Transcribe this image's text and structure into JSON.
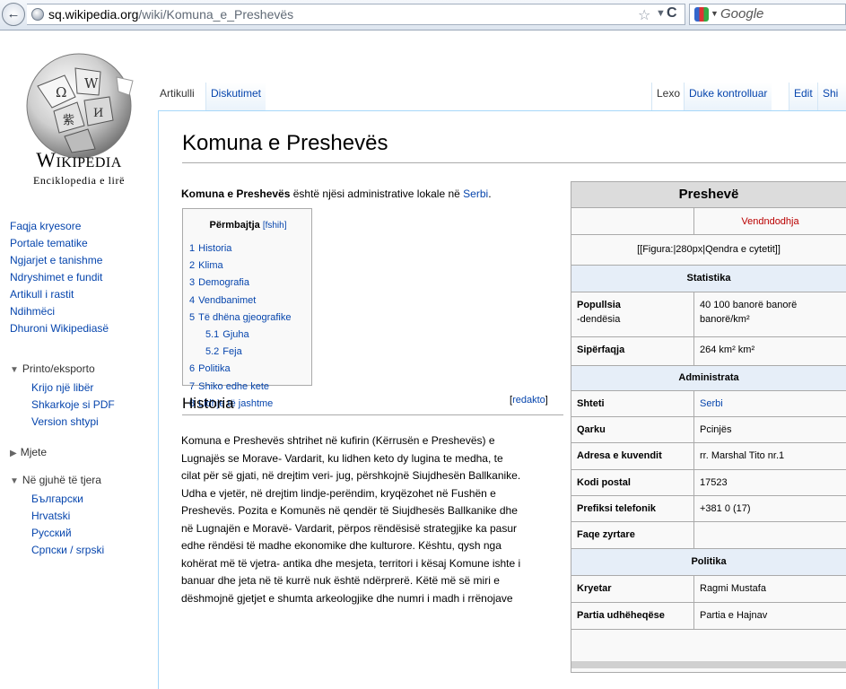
{
  "browser": {
    "url_host": "sq.wikipedia.org",
    "url_path": "/wiki/Komuna_e_Preshevës",
    "search_placeholder": "Google",
    "icons": [
      "back-arrow-icon",
      "site-identity-icon",
      "bookmark-star-icon",
      "dropdown-arrow-icon",
      "reload-icon",
      "search-engine-icon"
    ]
  },
  "logo": {
    "wordmark": "Wikipedia",
    "tagline": "Enciklopedia e lirë"
  },
  "nav": {
    "main": [
      "Faqja kryesore",
      "Portale tematike",
      "Ngjarjet e tanishme",
      "Ndryshimet e fundit",
      "Artikull i rastit",
      "Ndihmëci",
      "Dhuroni Wikipediasë"
    ],
    "print_heading": "Printo/eksporto",
    "print_items": [
      "Krijo një libër",
      "Shkarkoje si PDF",
      "Version shtypi"
    ],
    "tools_heading": "Mjete",
    "languages_heading": "Në gjuhë të tjera",
    "languages": [
      "Български",
      "Hrvatski",
      "Русский",
      "Српски / srpski"
    ]
  },
  "tabs": {
    "article": "Artikulli",
    "discussion": "Diskutimet",
    "read": "Lexo",
    "history": "Duke kontrolluar",
    "edit": "Edit",
    "more": "Shi"
  },
  "article": {
    "title": "Komuna e Preshevës",
    "lead_bold": "Komuna e Preshevës",
    "lead_text": " është njësi administrative lokale në ",
    "lead_link": "Serbi",
    "lead_end": "."
  },
  "toc": {
    "title": "Përmbajtja",
    "toggle_open": "[",
    "toggle": "fshih",
    "toggle_close": "]",
    "items": [
      {
        "num": "1",
        "label": "Historia",
        "sub": false
      },
      {
        "num": "2",
        "label": "Klima",
        "sub": false
      },
      {
        "num": "3",
        "label": "Demografia",
        "sub": false
      },
      {
        "num": "4",
        "label": "Vendbanimet",
        "sub": false
      },
      {
        "num": "5",
        "label": "Të dhëna gjeografike",
        "sub": false
      },
      {
        "num": "5.1",
        "label": "Gjuha",
        "sub": true
      },
      {
        "num": "5.2",
        "label": "Feja",
        "sub": true
      },
      {
        "num": "6",
        "label": "Politika",
        "sub": false
      },
      {
        "num": "7",
        "label": "Shiko edhe kete",
        "sub": false
      },
      {
        "num": "8",
        "label": "Lidhje të jashtme",
        "sub": false
      }
    ]
  },
  "historia": {
    "heading": "Historia",
    "edit_open": "[",
    "edit": "redakto",
    "edit_close": "]",
    "lines": [
      "Komuna e Preshevës shtrihet në kufirin (Kërrusën e Preshevës) e",
      "Lugnajës se Morave- Vardarit, ku lidhen keto dy lugina te medha, te",
      "cilat për së gjati, në drejtim veri- jug, përshkojnë Siujdhesën Ballkanike.",
      "Udha e vjetër, në drejtim lindje-perëndim, kryqëzohet në Fushën e",
      "Preshevës. Pozita e Komunës në qendër të Siujdhesës Ballkanike dhe",
      "në Lugnajën e Moravë- Vardarit, përpos rëndësisë strategjike ka pasur",
      "edhe rëndësi të madhe ekonomike dhe kulturore. Kështu, qysh nga",
      "kohërat më të vjetra- antika dhe mesjeta, territori i kësaj Komune ishte i",
      "banuar dhe jeta në të kurrë nuk është ndërprerë. Këtë më së miri e",
      "dëshmojnë gjetjet e shumta arkeologjike dhe numri i madh i rrënojave"
    ]
  },
  "infobox": {
    "title": "Preshevë",
    "location_map": "Vendndodhja",
    "figure": "[[Figura:|280px|Qendra e cytetit]]",
    "stats_heading": "Statistika",
    "population_label_1": "Popullsia",
    "population_label_2": "-dendësia",
    "population_value_1": "40 100 banorë banorë",
    "population_value_2": "banorë/km²",
    "area_label": "Sipërfaqja",
    "area_value": "264 km² km²",
    "admin_heading": "Administrata",
    "state_label": "Shteti",
    "state_value": "Serbi",
    "district_label": "Qarku",
    "district_value": "Pcinjës",
    "address_label": "Adresa e kuvendit",
    "address_value": "rr. Marshal Tito nr.1",
    "postal_label": "Kodi postal",
    "postal_value": "17523",
    "phone_label": "Prefiksi telefonik",
    "phone_value": "+381 0 (17)",
    "website_label": "Faqe zyrtare",
    "website_value": "",
    "politics_heading": "Politika",
    "mayor_label": "Kryetar",
    "mayor_value": "Ragmi Mustafa",
    "party_label": "Partia udhëheqëse",
    "party_value": "Partia e Hajnav"
  }
}
